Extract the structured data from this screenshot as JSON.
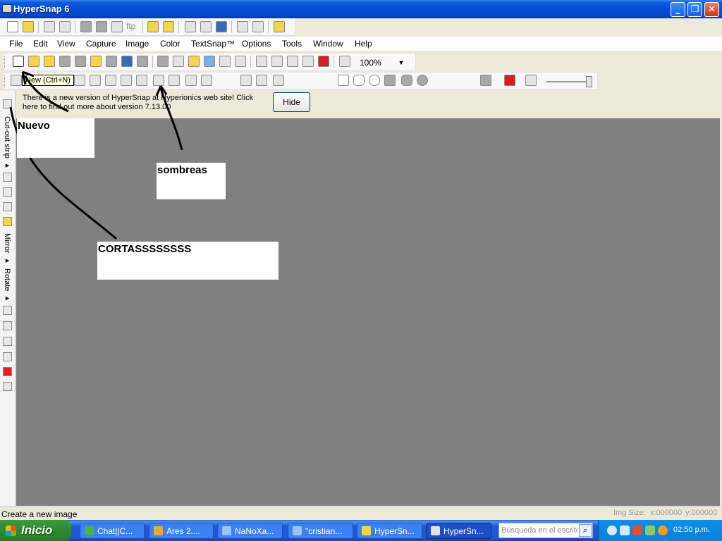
{
  "window": {
    "title": "HyperSnap 6",
    "minimize": "_",
    "restore": "❐",
    "close": "✕"
  },
  "toolbar1": {
    "ftp_label": "ftp"
  },
  "menu": [
    "File",
    "Edit",
    "View",
    "Capture",
    "Image",
    "Color",
    "TextSnap™",
    "Options",
    "Tools",
    "Window",
    "Help"
  ],
  "toolbar2": {
    "zoom": "100%"
  },
  "tooltip": "New (Ctrl+N)",
  "notification": {
    "text": "There is a new version of HyperSnap at Hyperionics web site! Click here to find out more about version 7.13.00",
    "hide_label": "Hide"
  },
  "left_strip": {
    "labels": [
      "Cut-out strip ▸",
      "Mirror ▸",
      "Rotate ▸"
    ]
  },
  "annotations": [
    "Nuevo",
    "sombreas",
    "CORTASSSSSSSS"
  ],
  "status": {
    "text": "Create a new image",
    "img_size": "Img Size:",
    "x": "x:000000",
    "y": "y:000000"
  },
  "taskbar": {
    "start_label": "Inicio",
    "tasks": [
      "Chat||C...",
      "Ares 2....",
      "NaNoXa...",
      "\"cristian...",
      "HyperSn...",
      "HyperSn..."
    ],
    "search_placeholder": "Búsqueda en el escritorio",
    "clock": "02:50 p.m."
  },
  "colors": {
    "workspace": "#808080",
    "titlebar": "#0550d6",
    "taskbar": "#2157d7",
    "start": "#2f8a2d"
  }
}
